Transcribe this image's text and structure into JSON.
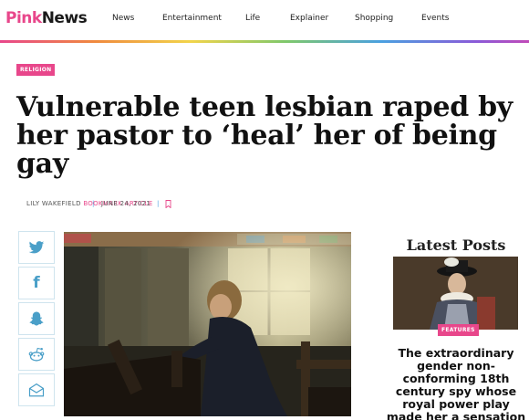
{
  "header": {
    "logo_pink": "Pink",
    "logo_news": "News",
    "nav": [
      "News",
      "Entertainment",
      "Life",
      "Explainer",
      "Shopping",
      "Events"
    ]
  },
  "article": {
    "category": "RELIGION",
    "headline": "Vulnerable teen lesbian raped by her pastor to ‘heal’ her of being gay",
    "author": "LILY WAKEFIELD",
    "separator": "|",
    "date": "JUNE 24, 2021",
    "bookmark_label": "BOOKMARK ARTICLE"
  },
  "share": {
    "icons": [
      "twitter-icon",
      "facebook-icon",
      "snapchat-icon",
      "reddit-icon",
      "email-icon"
    ],
    "facebook_glyph": "f"
  },
  "sidebar": {
    "title": "Latest Posts",
    "post_tag": "FEATURES",
    "post_headline": "The extraordinary gender non-conforming 18th century spy whose royal power play made her a sensation"
  },
  "colors": {
    "brand_pink": "#e8478b",
    "separator_blue": "#4aa0e0",
    "share_icon": "#4a9fc8"
  }
}
